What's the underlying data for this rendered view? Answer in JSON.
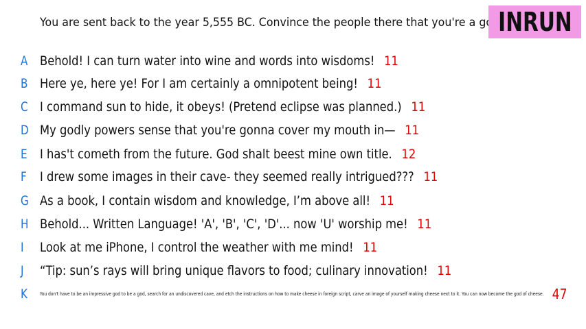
{
  "prompt": "You are sent back to the year 5,555 BC. Convince the people there that you're a god.",
  "badge": "INRUN",
  "colors": {
    "letter": "#1e73d8",
    "score": "#e00000",
    "badge_bg": "#f39ae6"
  },
  "answers": [
    {
      "letter": "A",
      "text": "Behold! I can turn water into wine and words into wisdoms!",
      "score": "11"
    },
    {
      "letter": "B",
      "text": "Here ye, here ye! For I am certainly a omnipotent being!",
      "score": "11"
    },
    {
      "letter": "C",
      "text": "I command sun to hide, it obeys! (Pretend eclipse was planned.)",
      "score": "11"
    },
    {
      "letter": "D",
      "text": "My godly powers sense that you're gonna cover my mouth in—",
      "score": "11"
    },
    {
      "letter": "E",
      "text": "I has't cometh from the future. God shalt beest mine own title.",
      "score": "12"
    },
    {
      "letter": "F",
      "text": "I drew some images in their cave- they seemed really intrigued???",
      "score": "11"
    },
    {
      "letter": "G",
      "text": "As a book, I contain wisdom and knowledge, I’m above all!",
      "score": "11"
    },
    {
      "letter": "H",
      "text": "Behold... Written Language! 'A', 'B', 'C', 'D'... now 'U' worship me!",
      "score": "11"
    },
    {
      "letter": "I",
      "text": "Look at me iPhone, I control the weather with me mind!",
      "score": "11"
    },
    {
      "letter": "J",
      "text": "“Tip: sun’s rays will bring unique flavors to food; culinary innovation!",
      "score": "11"
    },
    {
      "letter": "K",
      "text": "You don't have to be an impressive god to be a god, search for an undiscovered cave, and etch the instructions on how to make cheese in foreign script, carve an image of yourself making cheese next to it. You can now become the god of cheese.",
      "score": "47"
    }
  ]
}
